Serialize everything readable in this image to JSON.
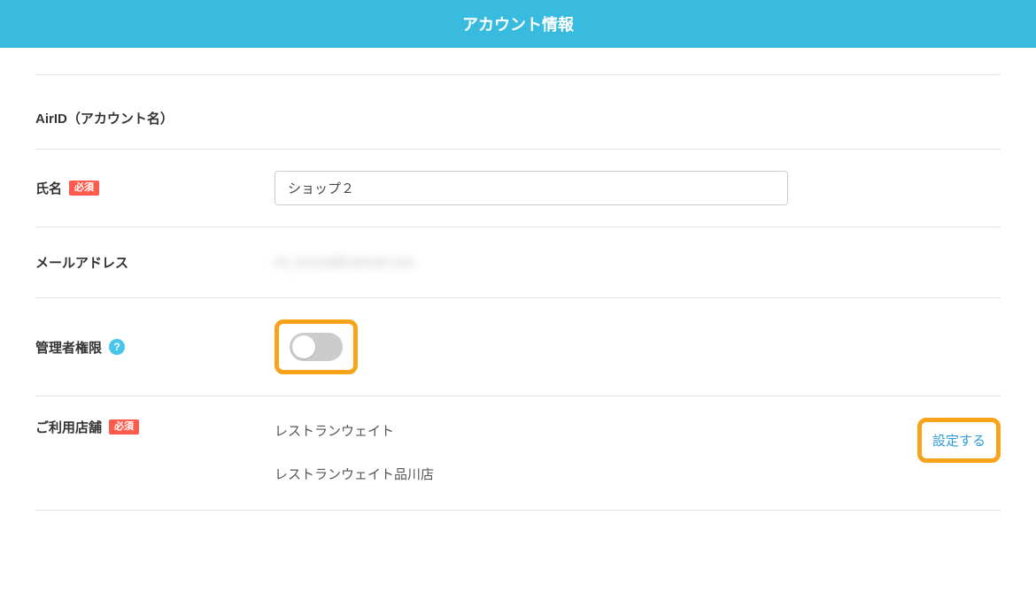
{
  "header": {
    "title": "アカウント情報"
  },
  "fields": {
    "airid": {
      "label": "AirID（アカウント名）",
      "value": ""
    },
    "name": {
      "label": "氏名",
      "required_badge": "必須",
      "value": "ショップ２"
    },
    "email": {
      "label": "メールアドレス",
      "value": "ml_bruna@hotmail.com"
    },
    "admin": {
      "label": "管理者権限",
      "help": "?"
    },
    "stores": {
      "label": "ご利用店舗",
      "required_badge": "必須",
      "action": "設定する",
      "items": [
        "レストランウェイト",
        "レストランウェイト品川店"
      ]
    }
  }
}
